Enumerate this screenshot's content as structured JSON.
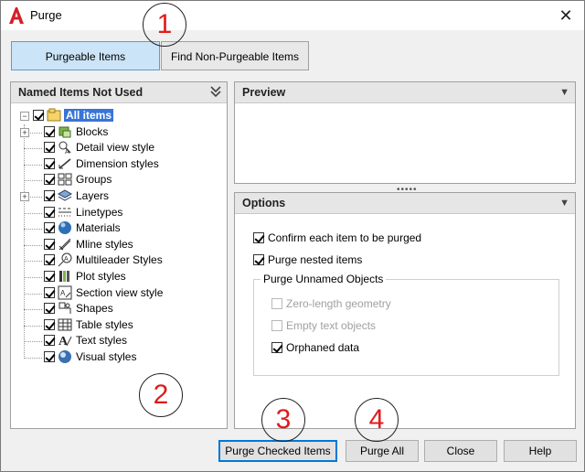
{
  "window": {
    "title": "Purge",
    "close_glyph": "✕"
  },
  "tabs": [
    {
      "label": "Purgeable Items",
      "active": true
    },
    {
      "label": "Find Non-Purgeable Items",
      "active": false
    }
  ],
  "left_panel": {
    "header": "Named Items Not Used",
    "header_icon": "double-chevron-down-icon"
  },
  "tree": {
    "root": {
      "label": "All items",
      "checked": true,
      "expanded": true
    },
    "items": [
      {
        "label": "Blocks",
        "checked": true,
        "expandable": true,
        "icon": "block-icon"
      },
      {
        "label": "Detail view style",
        "checked": true,
        "expandable": false,
        "icon": "detail-view-icon"
      },
      {
        "label": "Dimension styles",
        "checked": true,
        "expandable": false,
        "icon": "dimension-icon"
      },
      {
        "label": "Groups",
        "checked": true,
        "expandable": false,
        "icon": "groups-icon"
      },
      {
        "label": "Layers",
        "checked": true,
        "expandable": true,
        "icon": "layers-icon"
      },
      {
        "label": "Linetypes",
        "checked": true,
        "expandable": false,
        "icon": "linetype-icon"
      },
      {
        "label": "Materials",
        "checked": true,
        "expandable": false,
        "icon": "materials-icon"
      },
      {
        "label": "Mline styles",
        "checked": true,
        "expandable": false,
        "icon": "mline-icon"
      },
      {
        "label": "Multileader Styles",
        "checked": true,
        "expandable": false,
        "icon": "multileader-icon"
      },
      {
        "label": "Plot styles",
        "checked": true,
        "expandable": false,
        "icon": "plot-style-icon"
      },
      {
        "label": "Section view style",
        "checked": true,
        "expandable": false,
        "icon": "section-view-icon"
      },
      {
        "label": "Shapes",
        "checked": true,
        "expandable": false,
        "icon": "shapes-icon"
      },
      {
        "label": "Table styles",
        "checked": true,
        "expandable": false,
        "icon": "table-icon"
      },
      {
        "label": "Text styles",
        "checked": true,
        "expandable": false,
        "icon": "text-style-icon"
      },
      {
        "label": "Visual styles",
        "checked": true,
        "expandable": false,
        "icon": "visual-style-icon"
      }
    ]
  },
  "preview_panel": {
    "header": "Preview"
  },
  "options_panel": {
    "header": "Options",
    "confirm_each": {
      "label": "Confirm each item to be purged",
      "checked": true
    },
    "purge_nested": {
      "label": "Purge nested items",
      "checked": true
    },
    "unnamed_group": {
      "title": "Purge Unnamed Objects",
      "zero_length": {
        "label": "Zero-length geometry",
        "checked": false,
        "disabled": true
      },
      "empty_text": {
        "label": "Empty text objects",
        "checked": false,
        "disabled": true
      },
      "orphaned": {
        "label": "Orphaned data",
        "checked": true,
        "disabled": false
      }
    }
  },
  "buttons": {
    "purge_checked": "Purge Checked Items",
    "purge_all": "Purge All",
    "close": "Close",
    "help": "Help"
  },
  "annotations": [
    "1",
    "2",
    "3",
    "4"
  ],
  "colors": {
    "accent": "#0078d7",
    "selection": "#3875d7",
    "tab_active": "#cce4f7",
    "annotation": "#e01b1b",
    "app_icon": "#d3202a"
  }
}
